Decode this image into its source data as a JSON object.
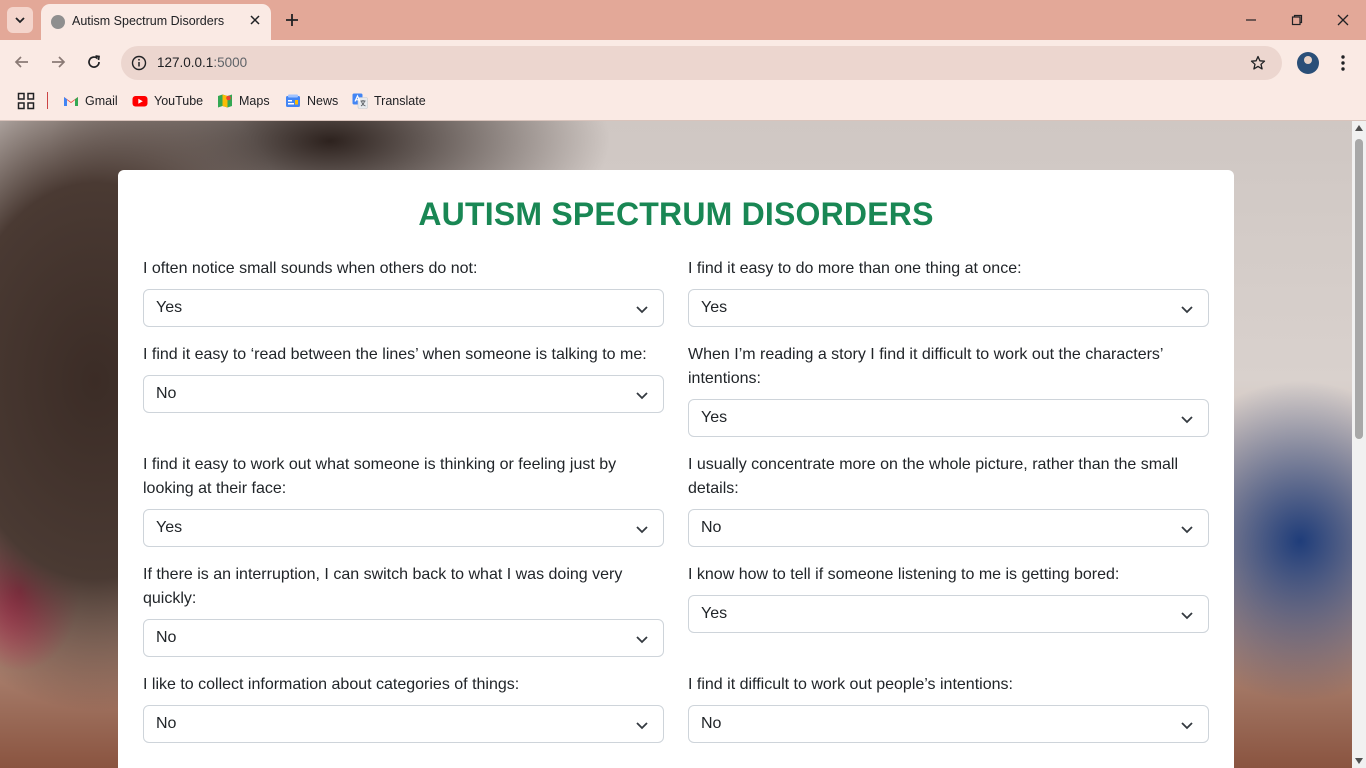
{
  "browser": {
    "tab_title": "Autism Spectrum Disorders",
    "url_host": "127.0.0.1",
    "url_port": ":5000",
    "bookmarks": [
      {
        "label": "Gmail",
        "icon": "gmail-icon"
      },
      {
        "label": "YouTube",
        "icon": "youtube-icon"
      },
      {
        "label": "Maps",
        "icon": "maps-icon"
      },
      {
        "label": "News",
        "icon": "news-icon"
      },
      {
        "label": "Translate",
        "icon": "translate-icon"
      }
    ]
  },
  "form": {
    "title": "AUTISM SPECTRUM DISORDERS",
    "questions": [
      {
        "label": "I often notice small sounds when others do not:",
        "value": "Yes"
      },
      {
        "label": "I find it easy to do more than one thing at once:",
        "value": "Yes"
      },
      {
        "label": "I find it easy to ‘read between the lines’ when someone is talking to me:",
        "value": "No"
      },
      {
        "label": "When I’m reading a story I find it difficult to work out the characters’ intentions:",
        "value": "Yes"
      },
      {
        "label": "I find it easy to work out what someone is thinking or feeling just by looking at their face:",
        "value": "Yes"
      },
      {
        "label": "I usually concentrate more on the whole picture, rather than the small details:",
        "value": "No"
      },
      {
        "label": "If there is an interruption, I can switch back to what I was doing very quickly:",
        "value": "No"
      },
      {
        "label": "I know how to tell if someone listening to me is getting bored:",
        "value": "Yes"
      },
      {
        "label": "I like to collect information about categories of things:",
        "value": "No"
      },
      {
        "label": "I find it difficult to work out people’s intentions:",
        "value": "No"
      }
    ]
  },
  "colors": {
    "title_green": "#198754",
    "chrome_tabbar": "#e3a898",
    "chrome_toolbar": "#faeae4"
  }
}
